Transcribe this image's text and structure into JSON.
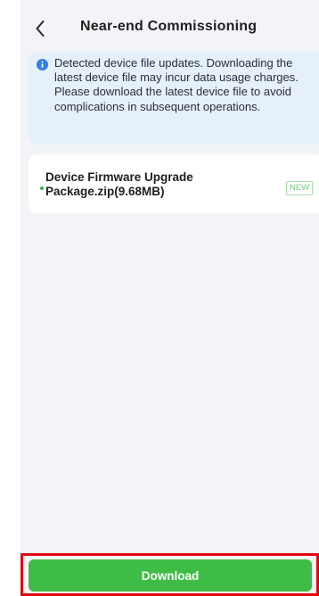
{
  "header": {
    "title": "Near-end Commissioning",
    "back_icon": "chevron-left-icon"
  },
  "notice": {
    "icon": "info-icon",
    "text": "Detected device file updates. Downloading the latest device file may incur data usage charges. Please download the latest device file to avoid complications in subsequent operations."
  },
  "files": [
    {
      "name": "Device Firmware Upgrade Package.zip(9.68MB)",
      "badge": "NEW"
    }
  ],
  "footer": {
    "download_label": "Download"
  },
  "colors": {
    "accent": "#3fbc46",
    "notice_bg": "#e6f0fb",
    "info_icon": "#2f7fe8",
    "badge_text": "#7ccb87",
    "highlight_border": "#e30613"
  }
}
